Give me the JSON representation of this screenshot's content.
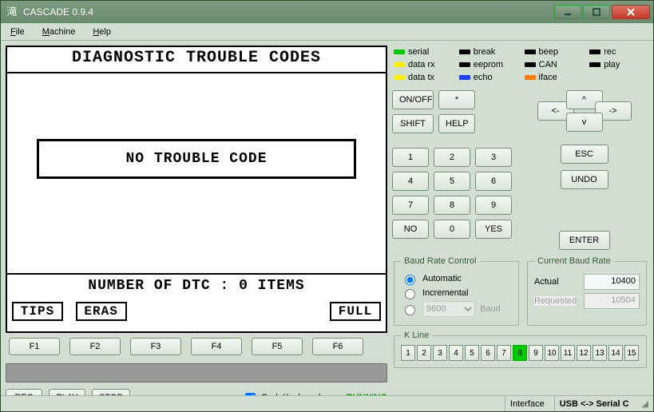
{
  "window": {
    "title": "CASCADE 0.9.4"
  },
  "menu": {
    "file": "File",
    "machine": "Machine",
    "help": "Help"
  },
  "lcd": {
    "title": "DIAGNOSTIC TROUBLE CODES",
    "message": "NO TROUBLE CODE",
    "footer": "NUMBER OF DTC   :   0 ITEMS",
    "soft": {
      "s1": "TIPS",
      "s2": "ERAS",
      "s3": "",
      "s4": "",
      "s5": "",
      "s6": "FULL"
    }
  },
  "fkeys": {
    "f1": "F1",
    "f2": "F2",
    "f3": "F3",
    "f4": "F4",
    "f5": "F5",
    "f6": "F6"
  },
  "bottom": {
    "rec": "REC",
    "play": "PLAY",
    "stop": "STOP",
    "grab": "Grab Keyboard",
    "grab_checked": true,
    "status": "RUNNING"
  },
  "leds": {
    "serial": {
      "label": "serial",
      "color": "#00cc00"
    },
    "break": {
      "label": "break",
      "color": "#000000"
    },
    "beep": {
      "label": "beep",
      "color": "#000000"
    },
    "rec": {
      "label": "rec",
      "color": "#000000"
    },
    "datarx": {
      "label": "data rx",
      "color": "#ffee00"
    },
    "eeprom": {
      "label": "eeprom",
      "color": "#000000"
    },
    "can": {
      "label": "CAN",
      "color": "#000000"
    },
    "play": {
      "label": "play",
      "color": "#000000"
    },
    "datatx": {
      "label": "data tx",
      "color": "#ffee00"
    },
    "echo": {
      "label": "echo",
      "color": "#2040ff"
    },
    "iface": {
      "label": "iface",
      "color": "#ff7a00"
    }
  },
  "pad": {
    "onoff": "ON/OFF",
    "star": "*",
    "shift": "SHIFT",
    "help": "HELP",
    "n1": "1",
    "n2": "2",
    "n3": "3",
    "n4": "4",
    "n5": "5",
    "n6": "6",
    "n7": "7",
    "n8": "8",
    "n9": "9",
    "n0": "0",
    "no": "NO",
    "yes": "YES",
    "left": "<-",
    "right": "->",
    "up": "^",
    "down": "v",
    "esc": "ESC",
    "undo": "UNDO",
    "enter": "ENTER"
  },
  "baud_ctl": {
    "legend": "Baud Rate Control",
    "auto": "Automatic",
    "inc": "Incremental",
    "manual_value": "9600",
    "unit": "Baud",
    "selected": "auto"
  },
  "baud_cur": {
    "legend": "Current Baud Rate",
    "actual_lbl": "Actual",
    "actual_val": "10400",
    "req_lbl": "Requested",
    "req_val": "10504"
  },
  "kline": {
    "legend": "K Line",
    "cells": [
      "1",
      "2",
      "3",
      "4",
      "5",
      "6",
      "7",
      "8",
      "9",
      "10",
      "11",
      "12",
      "13",
      "14",
      "15"
    ],
    "active_index": 7
  },
  "statusbar": {
    "iface_lbl": "Interface",
    "iface_val": "USB <-> Serial C"
  }
}
